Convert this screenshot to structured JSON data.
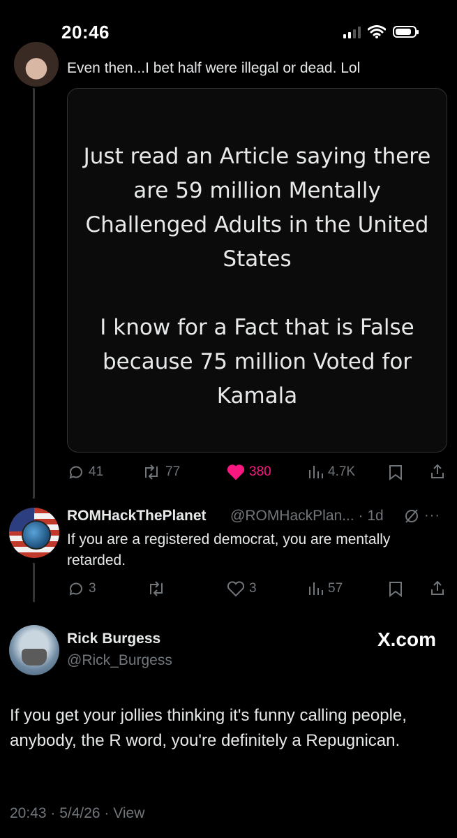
{
  "status_bar": {
    "time": "20:46",
    "signal_bars": 2,
    "battery_level": 0.85
  },
  "reply_1": {
    "text": "Even then...I bet half were illegal or dead. Lol",
    "quote_card": {
      "paragraph_1": "Just read an Article saying there are 59 million Mentally Challenged Adults in the United States",
      "paragraph_2": "I know for a Fact that is False because 75 million Voted for Kamala"
    },
    "actions": {
      "replies": "41",
      "reposts": "77",
      "likes": "380",
      "views": "4.7K",
      "liked": true
    }
  },
  "reply_2": {
    "name": "ROMHackThePlanet",
    "handle_time": "@ROMHackPlan... · 1d",
    "more": "···",
    "text": "If you are a registered democrat, you are mentally retarded.",
    "actions": {
      "replies": "3",
      "reposts": "",
      "likes": "3",
      "views": "57"
    }
  },
  "main_tweet": {
    "name": "Rick Burgess",
    "handle": "@Rick_Burgess",
    "watermark": "X.com",
    "text": "If you get your jollies thinking it's funny calling people, anybody, the R word, you're definitely a Repugnican.",
    "meta": "20:43 · 5/4/26 · View"
  },
  "colors": {
    "background": "#000000",
    "text": "#e7e9ea",
    "muted": "#71767b",
    "like": "#f91880",
    "border": "#2f3336"
  }
}
